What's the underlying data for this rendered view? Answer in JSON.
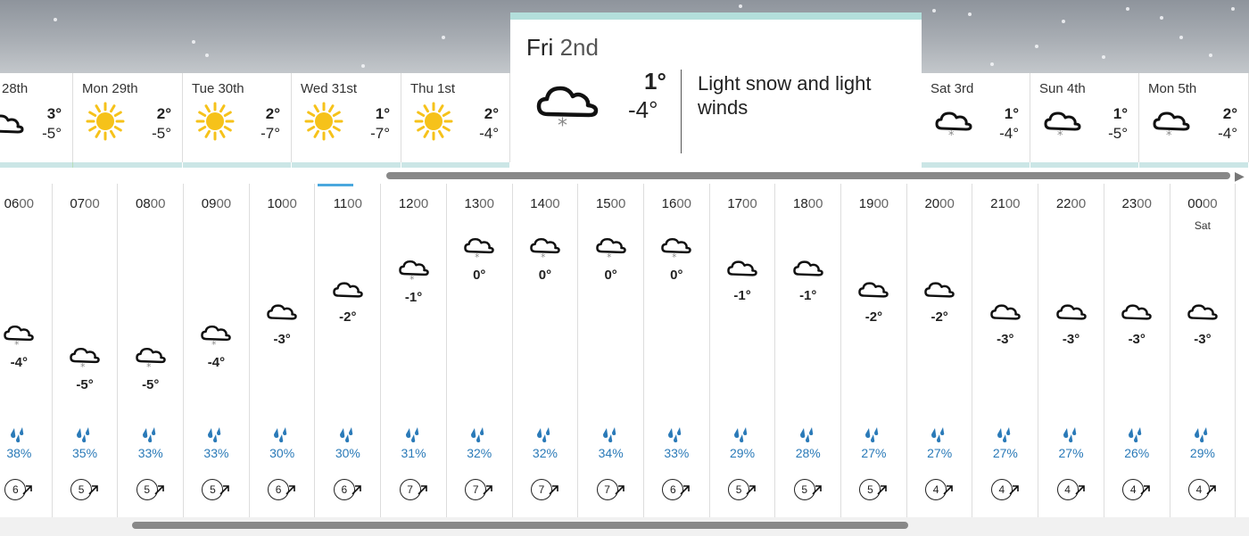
{
  "selected_day": {
    "day": "Fri",
    "date": "2nd",
    "high": "1°",
    "low": "-4°",
    "summary": "Light snow and light winds",
    "icon": "cloud-snow-icon"
  },
  "days": [
    {
      "name": "28th",
      "high": "3°",
      "low": "-5°",
      "icon": "cloud-icon"
    },
    {
      "name": "Mon 29th",
      "high": "2°",
      "low": "-5°",
      "icon": "sun-icon"
    },
    {
      "name": "Tue 30th",
      "high": "2°",
      "low": "-7°",
      "icon": "sun-icon"
    },
    {
      "name": "Wed 31st",
      "high": "1°",
      "low": "-7°",
      "icon": "sun-icon"
    },
    {
      "name": "Thu 1st",
      "high": "2°",
      "low": "-4°",
      "icon": "sun-icon"
    },
    {
      "name": "Sat 3rd",
      "high": "1°",
      "low": "-4°",
      "icon": "cloud-snow-icon"
    },
    {
      "name": "Sun 4th",
      "high": "1°",
      "low": "-5°",
      "icon": "cloud-snow-icon"
    },
    {
      "name": "Mon 5th",
      "high": "2°",
      "low": "-4°",
      "icon": "cloud-snow-icon"
    }
  ],
  "hours": [
    {
      "hh": "06",
      "mm": "00",
      "temp": "-4°",
      "t": -4,
      "icon": "cloud-snow-icon",
      "rain": "38%",
      "wind": "6"
    },
    {
      "hh": "07",
      "mm": "00",
      "temp": "-5°",
      "t": -5,
      "icon": "cloud-snow-icon",
      "rain": "35%",
      "wind": "5"
    },
    {
      "hh": "08",
      "mm": "00",
      "temp": "-5°",
      "t": -5,
      "icon": "cloud-snow-icon",
      "rain": "33%",
      "wind": "5"
    },
    {
      "hh": "09",
      "mm": "00",
      "temp": "-4°",
      "t": -4,
      "icon": "cloud-snow-icon",
      "rain": "33%",
      "wind": "5"
    },
    {
      "hh": "10",
      "mm": "00",
      "temp": "-3°",
      "t": -3,
      "icon": "cloud-icon",
      "rain": "30%",
      "wind": "6"
    },
    {
      "hh": "11",
      "mm": "00",
      "temp": "-2°",
      "t": -2,
      "icon": "cloud-icon",
      "rain": "30%",
      "wind": "6"
    },
    {
      "hh": "12",
      "mm": "00",
      "temp": "-1°",
      "t": -1,
      "icon": "cloud-snow-icon",
      "rain": "31%",
      "wind": "7"
    },
    {
      "hh": "13",
      "mm": "00",
      "temp": "0°",
      "t": 0,
      "icon": "cloud-snow-icon",
      "rain": "32%",
      "wind": "7"
    },
    {
      "hh": "14",
      "mm": "00",
      "temp": "0°",
      "t": 0,
      "icon": "cloud-snow-icon",
      "rain": "32%",
      "wind": "7"
    },
    {
      "hh": "15",
      "mm": "00",
      "temp": "0°",
      "t": 0,
      "icon": "cloud-snow-icon",
      "rain": "34%",
      "wind": "7"
    },
    {
      "hh": "16",
      "mm": "00",
      "temp": "0°",
      "t": 0,
      "icon": "cloud-snow-icon",
      "rain": "33%",
      "wind": "6"
    },
    {
      "hh": "17",
      "mm": "00",
      "temp": "-1°",
      "t": -1,
      "icon": "cloud-icon",
      "rain": "29%",
      "wind": "5"
    },
    {
      "hh": "18",
      "mm": "00",
      "temp": "-1°",
      "t": -1,
      "icon": "cloud-icon",
      "rain": "28%",
      "wind": "5"
    },
    {
      "hh": "19",
      "mm": "00",
      "temp": "-2°",
      "t": -2,
      "icon": "cloud-icon",
      "rain": "27%",
      "wind": "5"
    },
    {
      "hh": "20",
      "mm": "00",
      "temp": "-2°",
      "t": -2,
      "icon": "cloud-icon",
      "rain": "27%",
      "wind": "4"
    },
    {
      "hh": "21",
      "mm": "00",
      "temp": "-3°",
      "t": -3,
      "icon": "cloud-icon",
      "rain": "27%",
      "wind": "4"
    },
    {
      "hh": "22",
      "mm": "00",
      "temp": "-3°",
      "t": -3,
      "icon": "cloud-icon",
      "rain": "27%",
      "wind": "4"
    },
    {
      "hh": "23",
      "mm": "00",
      "temp": "-3°",
      "t": -3,
      "icon": "cloud-icon",
      "rain": "26%",
      "wind": "4"
    },
    {
      "hh": "00",
      "mm": "00",
      "sub": "Sat",
      "temp": "-3°",
      "t": -3,
      "icon": "cloud-icon",
      "rain": "29%",
      "wind": "4"
    }
  ],
  "colors": {
    "accent_teal": "#b3dfdb",
    "rain_blue": "#2a7ab8",
    "sun_yellow": "#f6c21a"
  }
}
